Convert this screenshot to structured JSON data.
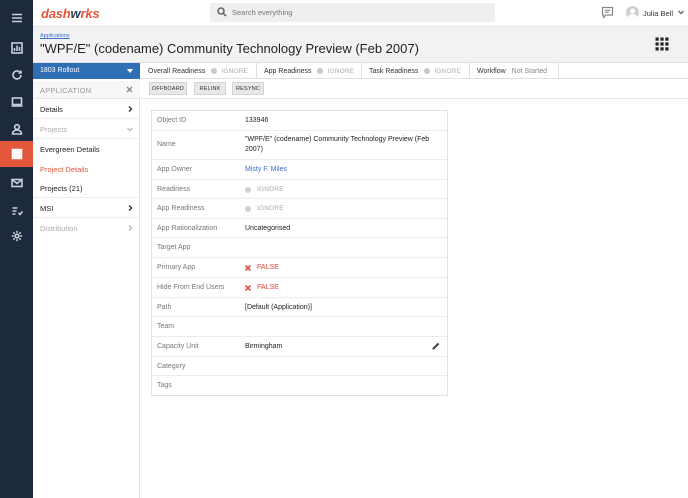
{
  "app": {
    "logo_part1": "dash",
    "logo_part2": "w",
    "logo_part3": "rks"
  },
  "search": {
    "placeholder": "Search everything"
  },
  "user": {
    "name": "Julia Bell"
  },
  "header": {
    "breadcrumb": "Applications",
    "title": "\"WPF/E\" (codename) Community Technology Preview (Feb 2007)"
  },
  "sidebar": {
    "rollout": "1803 Rollout",
    "section_title": "APPLICATION",
    "items": [
      {
        "label": "Details",
        "state": "expandable"
      },
      {
        "label": "Projects",
        "state": "expanded"
      },
      {
        "label": "Evergreen Details"
      },
      {
        "label": "Project Details",
        "active": true
      },
      {
        "label": "Projects (21)"
      },
      {
        "label": "MSI",
        "state": "expandable"
      },
      {
        "label": "Distribution",
        "state": "disabled"
      }
    ]
  },
  "tabs": [
    {
      "label": "Overall Readiness",
      "value": "IGNORE"
    },
    {
      "label": "App Readiness",
      "value": "IGNORE"
    },
    {
      "label": "Task Readiness",
      "value": "IGNORE"
    },
    {
      "label": "Workflow",
      "value": "Not Started"
    }
  ],
  "actions": [
    "OFFBOARD",
    "RELINK",
    "RESYNC"
  ],
  "details": [
    {
      "label": "Object ID",
      "value": "133946"
    },
    {
      "label": "Name",
      "value": "\"WPF/E\" (codename) Community Technology Preview (Feb 2007)"
    },
    {
      "label": "App Owner",
      "value": "Misty F. Miles"
    },
    {
      "label": "Readiness",
      "value": "IGNORE"
    },
    {
      "label": "App Readiness",
      "value": "IGNORE"
    },
    {
      "label": "App Rationalization",
      "value": "Uncategorised"
    },
    {
      "label": "Target App",
      "value": ""
    },
    {
      "label": "Primary App",
      "value": "FALSE"
    },
    {
      "label": "Hide From End Users",
      "value": "FALSE"
    },
    {
      "label": "Path",
      "value": "[Default (Application)]"
    },
    {
      "label": "Team",
      "value": ""
    },
    {
      "label": "Capacity Unit",
      "value": "Birmingham"
    },
    {
      "label": "Category",
      "value": ""
    },
    {
      "label": "Tags",
      "value": ""
    }
  ],
  "colors": {
    "brand": "#e2563b",
    "rail": "#1d2a3d",
    "rollout": "#2f6fb6",
    "false": "#e2463b",
    "link": "#3b6ccc"
  }
}
